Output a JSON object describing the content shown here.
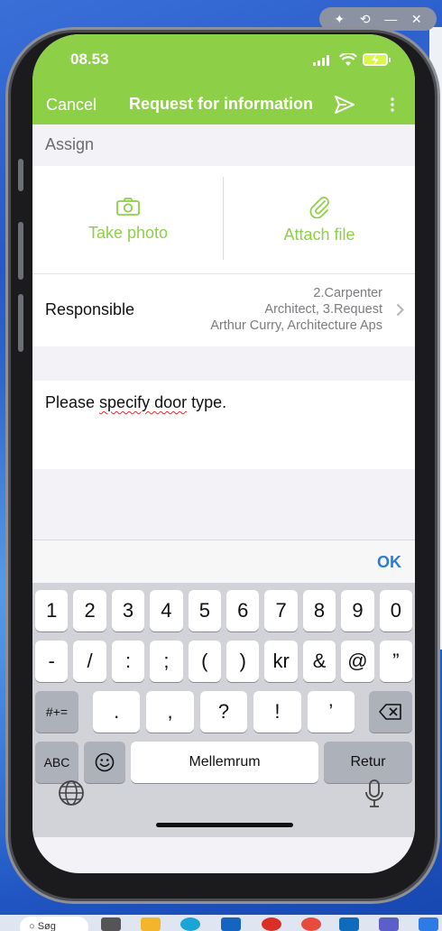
{
  "status_bar": {
    "time": "08.53"
  },
  "nav": {
    "cancel_label": "Cancel",
    "title": "Request for information"
  },
  "assign": {
    "section_label": "Assign"
  },
  "actions": {
    "take_photo_label": "Take photo",
    "attach_file_label": "Attach file"
  },
  "responsible": {
    "label": "Responsible",
    "value_lines": [
      "2.Carpenter",
      "Architect, 3.Request",
      "Arthur Curry, Architecture Aps"
    ]
  },
  "note": {
    "text_pre": "Please ",
    "text_misspelled": "specify door",
    "text_post": " type."
  },
  "accessory": {
    "ok_label": "OK"
  },
  "keyboard": {
    "row1": [
      "1",
      "2",
      "3",
      "4",
      "5",
      "6",
      "7",
      "8",
      "9",
      "0"
    ],
    "row2": [
      "-",
      "/",
      ":",
      ";",
      "(",
      ")",
      "kr",
      "&",
      "@",
      "”"
    ],
    "row3": [
      "#+=",
      ".",
      ",",
      "?",
      "!",
      "’"
    ],
    "abc_label": "ABC",
    "space_label": "Mellemrum",
    "return_label": "Retur"
  },
  "taskbar": {
    "search_label": "Søg"
  },
  "colors": {
    "accent": "#8dd047",
    "ok_blue": "#2b7cd3"
  }
}
